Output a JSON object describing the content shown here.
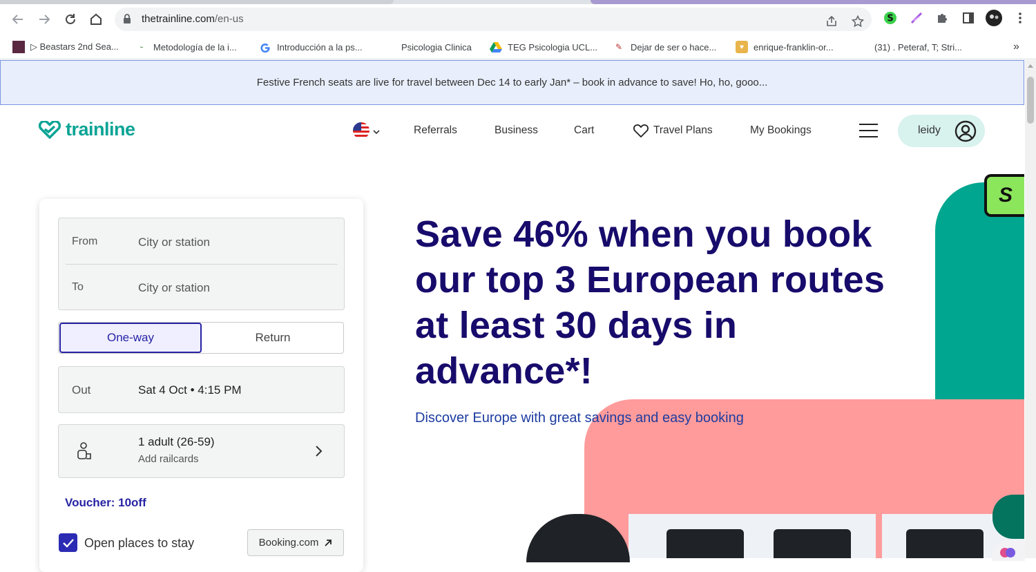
{
  "browser": {
    "url_domain": "thetrainline.com",
    "url_path": "/en-us",
    "bookmarks": [
      {
        "label": "▷ Beastars 2nd Sea...",
        "icon": "beastars-icon"
      },
      {
        "label": "Metodología de la i...",
        "icon": "scielo-icon"
      },
      {
        "label": "Introducción a la ps...",
        "icon": "google-icon"
      },
      {
        "label": "Psicologia Clinica",
        "icon": "dialnet-icon"
      },
      {
        "label": "TEG Psicologia UCL...",
        "icon": "google-drive-icon"
      },
      {
        "label": "Dejar de ser o hace...",
        "icon": "pen-icon"
      },
      {
        "label": "enrique-franklin-or...",
        "icon": "scribd-icon"
      },
      {
        "label": "(31) . Peteraf, T; Stri...",
        "icon": "academia-icon"
      }
    ]
  },
  "banner": {
    "text": "Festive French seats are live for travel between Dec 14 to early Jan* – book in advance to save! Ho, ho, gooo..."
  },
  "header": {
    "logo_text": "trainline",
    "nav": {
      "referrals": "Referrals",
      "business": "Business",
      "cart": "Cart",
      "travel_plans": "Travel Plans",
      "my_bookings": "My Bookings"
    },
    "user_name": "leidy"
  },
  "search": {
    "from_label": "From",
    "from_placeholder": "City or station",
    "to_label": "To",
    "to_placeholder": "City or station",
    "one_way": "One-way",
    "return": "Return",
    "out_label": "Out",
    "out_value": "Sat 4 Oct • 4:15 PM",
    "passengers": "1 adult (26-59)",
    "railcards": "Add railcards",
    "voucher": "Voucher: 10off",
    "stay_label": "Open places to stay",
    "booking_button": "Booking.com"
  },
  "hero": {
    "title": "Save 46% when you book our top 3 European routes at least 30 days in advance*!",
    "subtitle": "Discover Europe with great savings and easy booking",
    "badge_letter": "S"
  },
  "colors": {
    "brand": "#0aa495",
    "hero_title": "#170b6b",
    "accent": "#2723a3"
  }
}
